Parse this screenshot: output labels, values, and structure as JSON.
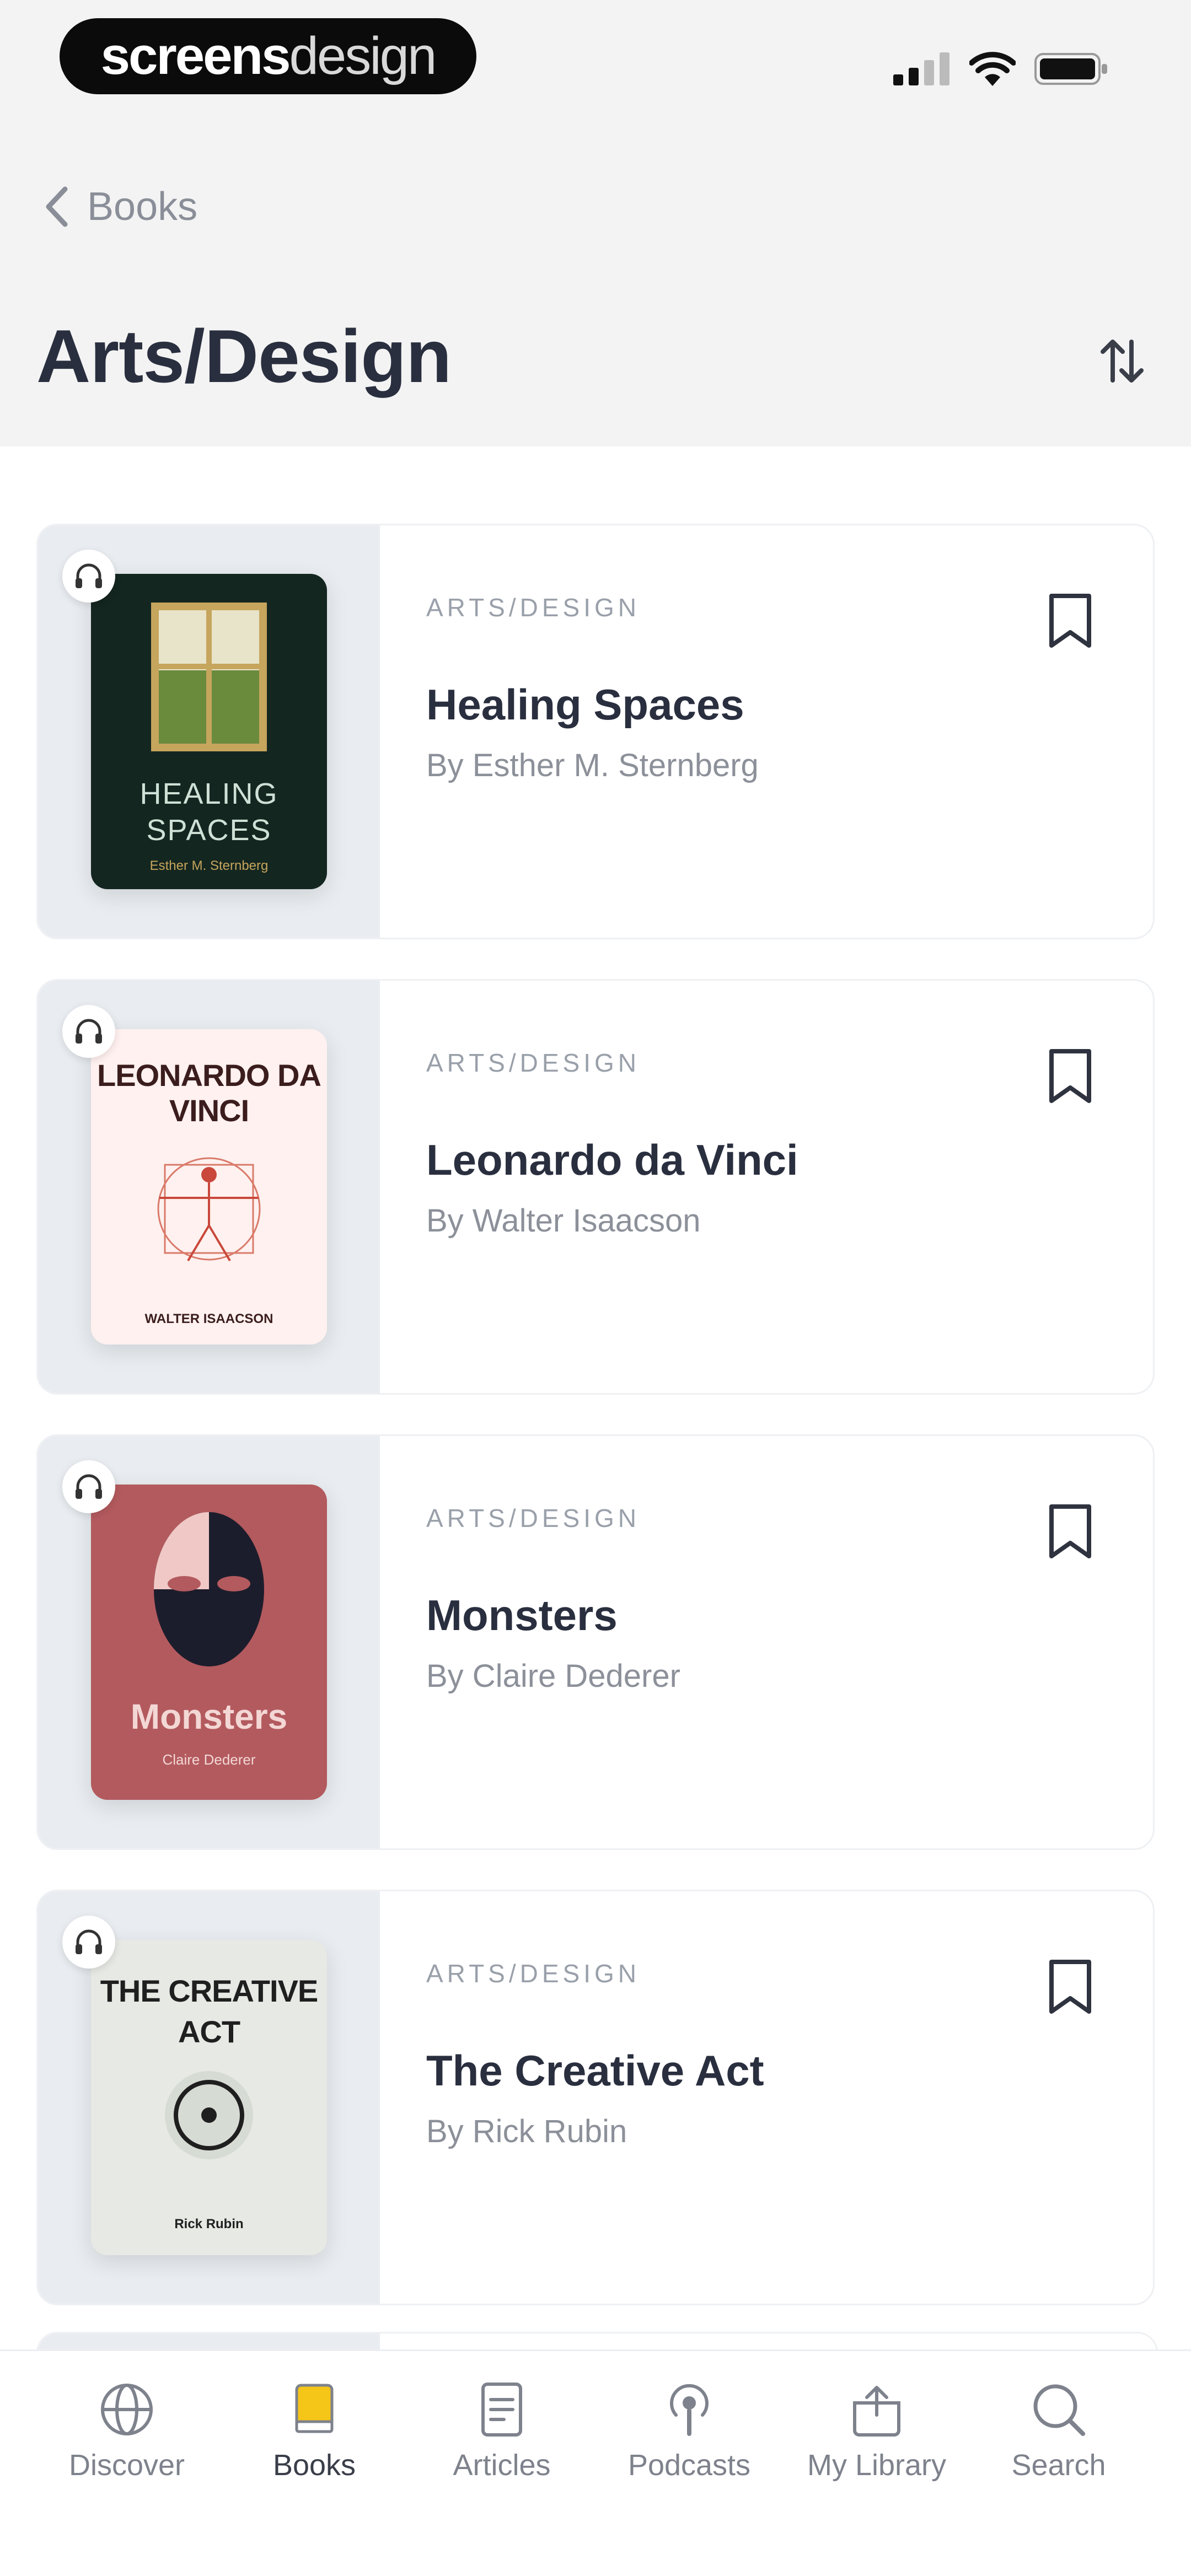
{
  "status_bar": {
    "brand_part1": "screens",
    "brand_part2": "design"
  },
  "nav": {
    "back_label": "Books",
    "title": "Arts/Design"
  },
  "books": [
    {
      "category": "ARTS/DESIGN",
      "title": "Healing Spaces",
      "author": "By Esther M. Sternberg",
      "cover_title": "HEALING SPACES",
      "cover_author": "Esther M. Sternberg"
    },
    {
      "category": "ARTS/DESIGN",
      "title": "Leonardo da Vinci",
      "author": "By Walter Isaacson",
      "cover_title": "LEONARDO DA VINCI",
      "cover_author": "WALTER ISAACSON"
    },
    {
      "category": "ARTS/DESIGN",
      "title": "Monsters",
      "author": "By Claire Dederer",
      "cover_title": "Monsters",
      "cover_author": "Claire Dederer"
    },
    {
      "category": "ARTS/DESIGN",
      "title": "The Creative Act",
      "author": "By Rick Rubin",
      "cover_title": "THE CREATIVE ACT",
      "cover_author": "Rick Rubin"
    }
  ],
  "tab_bar": {
    "active": "Books",
    "items": [
      "Discover",
      "Books",
      "Articles",
      "Podcasts",
      "My Library",
      "Search"
    ]
  },
  "colors": {
    "accent": "#f5c518",
    "header_bg": "#f3f3f3",
    "cover_panel": "#e9edf1",
    "text_primary": "#2a2f3f",
    "text_muted": "#8c9099"
  }
}
